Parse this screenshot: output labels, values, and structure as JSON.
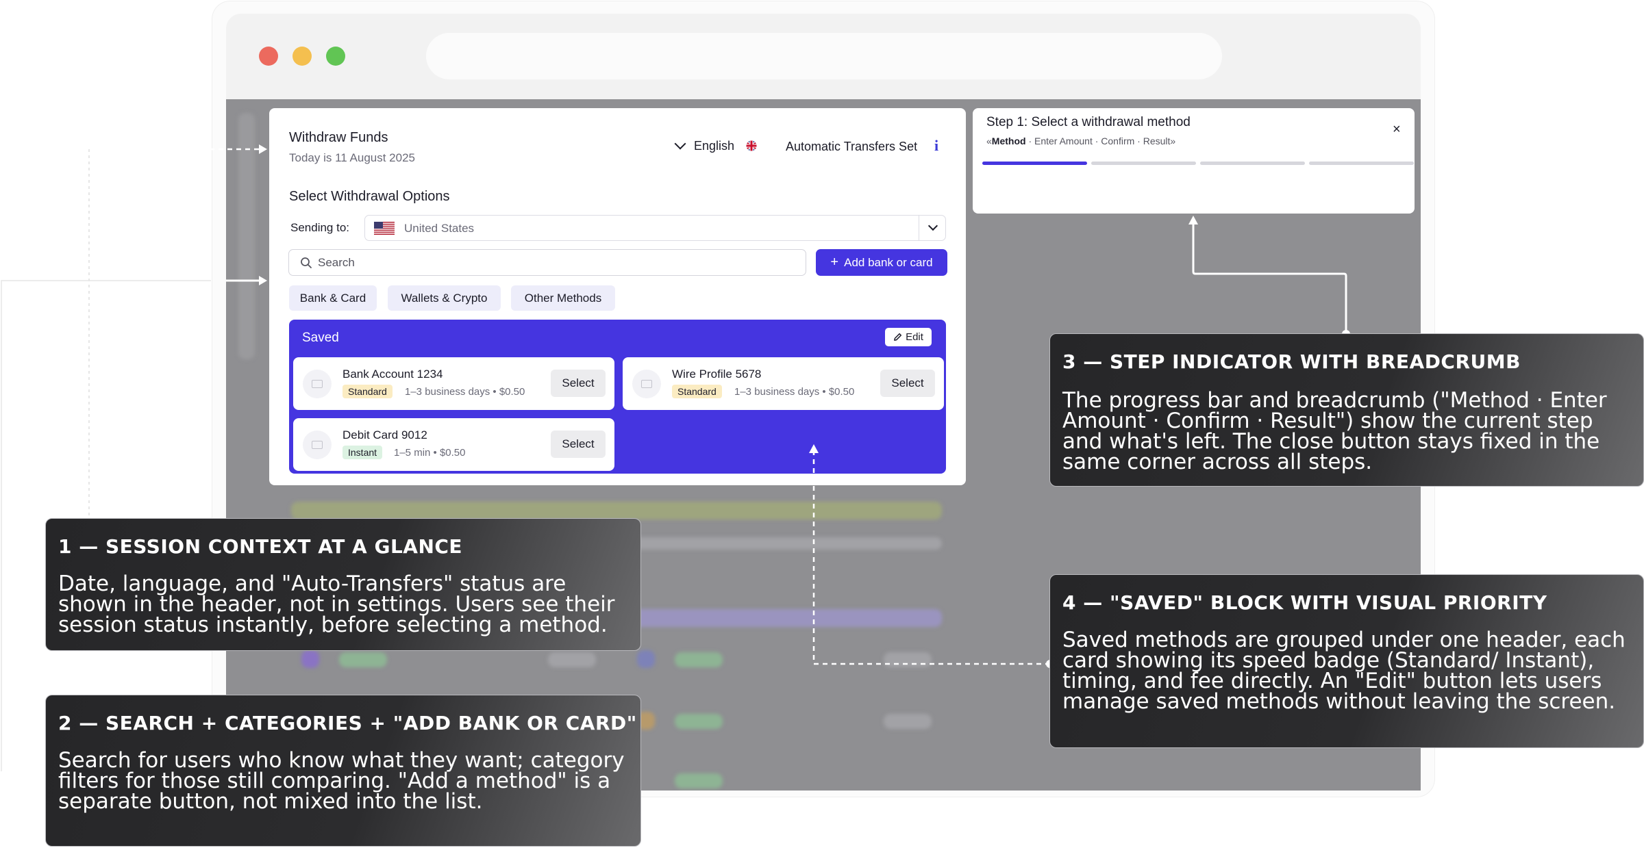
{
  "modal": {
    "title": "Withdraw Funds",
    "date": "Today is 11 August 2025",
    "language": "English",
    "auto_transfers": "Automatic Transfers Set",
    "info": "i",
    "section_title": "Select Withdrawal Options",
    "sending_label": "Sending to:",
    "country": "United States",
    "search_placeholder": "Search",
    "add_button": "Add bank or card",
    "categories": [
      "Bank & Card",
      "Wallets & Crypto",
      "Other Methods"
    ],
    "saved": {
      "title": "Saved",
      "edit_label": "Edit",
      "select_label": "Select",
      "cards": [
        {
          "name": "Bank Account 1234",
          "badge": "Standard",
          "meta": "1–3 business days • $0.50"
        },
        {
          "name": "Wire Profile 5678",
          "badge": "Standard",
          "meta": "1–3 business days • $0.50"
        },
        {
          "name": "Debit Card 9012",
          "badge": "Instant",
          "meta": "1–5 min • $0.50"
        }
      ]
    }
  },
  "step": {
    "title": "Step 1: Select a withdrawal method",
    "crumb_prefix": "«",
    "crumb_current": "Method",
    "crumb_rest": " · Enter Amount · Confirm · Result»",
    "close": "×",
    "progress_total": 4,
    "progress_current": 1
  },
  "callouts": [
    {
      "heading": "1 — SESSION CONTEXT  AT A GLANCE",
      "body": "Date, language, and \"Auto-Transfers\" status are shown in the header, not in settings. Users see their session status instantly, before selecting a method."
    },
    {
      "heading": "2 — SEARCH + CATEGORIES +  \"ADD BANK OR CARD\"",
      "body": "Search for users who know what they want; category filters for those still comparing. \"Add a method\" is a separate button, not mixed into the list."
    },
    {
      "heading": "3 — STEP INDICATOR WITH BREADCRUMB",
      "body": "The progress bar and breadcrumb (\"Method · Enter Amount · Confirm · Result\") show the current step and what's left. The close button stays fixed in the same corner across all steps."
    },
    {
      "heading": "4 — \"SAVED\" BLOCK WITH VISUAL PRIORITY",
      "body": "Saved methods are grouped under one header, each card showing its speed badge (Standard/ Instant), timing, and fee directly. An \"Edit\" button lets users manage saved methods without leaving the screen."
    }
  ],
  "colors": {
    "accent": "#4535e0",
    "standard_badge": "#fbecc2",
    "instant_badge": "#dcf2e2",
    "dot_red": "#ec6a5e",
    "dot_yellow": "#f4bf4f",
    "dot_green": "#61c554"
  }
}
